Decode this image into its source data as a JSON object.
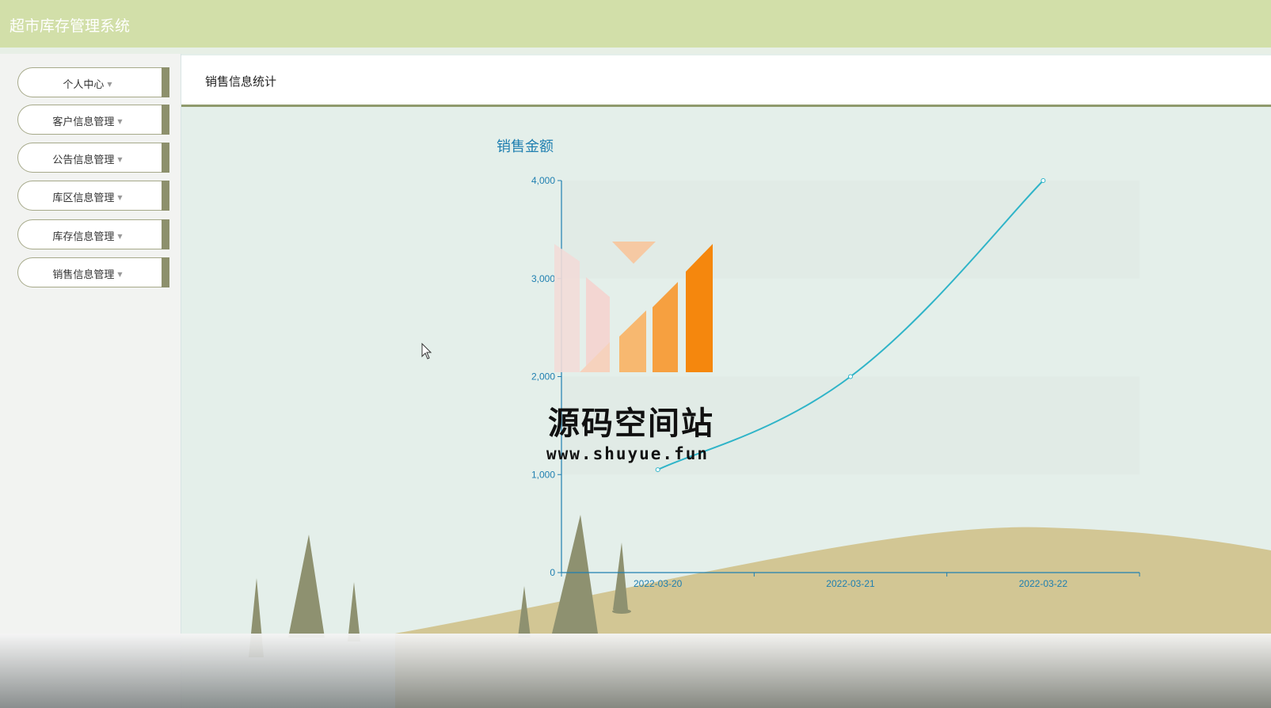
{
  "app": {
    "title": "超市库存管理系统"
  },
  "sidebar": {
    "items": [
      {
        "label": "个人中心",
        "icon": "caret-down-icon"
      },
      {
        "label": "客户信息管理",
        "icon": "caret-down-icon"
      },
      {
        "label": "公告信息管理",
        "icon": "caret-down-icon"
      },
      {
        "label": "库区信息管理",
        "icon": "caret-down-icon"
      },
      {
        "label": "库存信息管理",
        "icon": "caret-down-icon"
      },
      {
        "label": "销售信息管理",
        "icon": "caret-down-icon"
      }
    ]
  },
  "content": {
    "title": "销售信息统计"
  },
  "watermark": {
    "name": "源码空间站",
    "url": "www.shuyue.fun"
  },
  "colors": {
    "topbar": "#d2dfa9",
    "accent": "#8d906c",
    "line": "#2fb4c8",
    "axis": "#1f7fb0",
    "hill": "#d2c694",
    "tree": "#8e9170"
  },
  "chart_data": {
    "type": "line",
    "title": "销售金额",
    "categories": [
      "2022-03-20",
      "2022-03-21",
      "2022-03-22"
    ],
    "series": [
      {
        "values": [
          1050,
          2000,
          4000
        ]
      }
    ],
    "ylim": [
      0,
      4000
    ],
    "yticks": [
      "0",
      "1,000",
      "2,000",
      "3,000",
      "4,000"
    ],
    "xlabel": "",
    "ylabel": "",
    "grid": "alternating bands",
    "smooth": true
  }
}
